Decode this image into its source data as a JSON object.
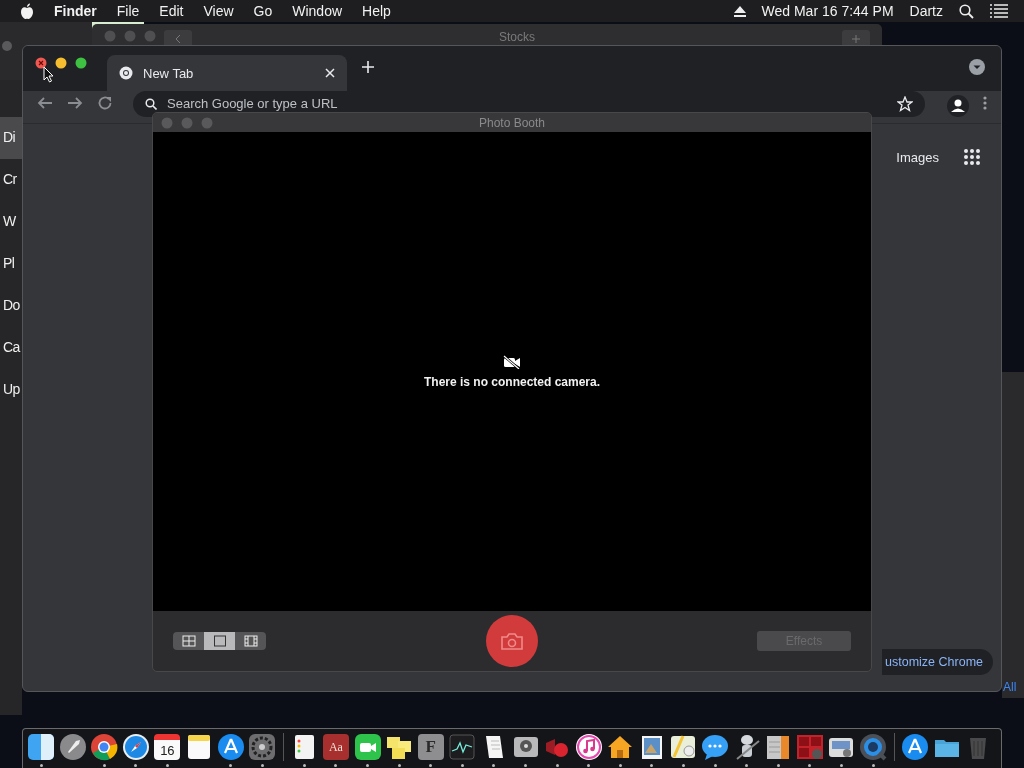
{
  "menu_bar": {
    "app": "Finder",
    "menus": [
      "File",
      "Edit",
      "View",
      "Go",
      "Window",
      "Help"
    ],
    "clock": "Wed Mar 16  7:44 PM",
    "user": "Dartz"
  },
  "background": {
    "stocks_title": "Stocks",
    "sidebar_items": [
      {
        "label": "Di",
        "selected": true
      },
      {
        "label": "Cr",
        "selected": false
      },
      {
        "label": "W",
        "selected": false
      },
      {
        "label": "Pl",
        "selected": false
      },
      {
        "label": "Do",
        "selected": false
      },
      {
        "label": "Ca",
        "selected": false
      },
      {
        "label": "Up",
        "selected": false
      }
    ],
    "right_link": "All"
  },
  "chrome": {
    "tab": {
      "title": "New Tab"
    },
    "omnibox": {
      "placeholder": "Search Google or type a URL"
    },
    "links": [
      "Images"
    ],
    "customize_button": "ustomize Chrome"
  },
  "photo_booth": {
    "title": "Photo Booth",
    "message": "There is no connected camera.",
    "view_modes": [
      {
        "kind": "grid",
        "selected": false
      },
      {
        "kind": "single",
        "selected": true
      },
      {
        "kind": "strip",
        "selected": false
      }
    ],
    "effects": {
      "label": "Effects",
      "disabled": true
    }
  },
  "dock": {
    "items": [
      {
        "kind": "app",
        "running": true
      },
      {
        "kind": "app",
        "running": false
      },
      {
        "kind": "app",
        "running": true
      },
      {
        "kind": "app",
        "running": true
      },
      {
        "kind": "app",
        "running": true,
        "text": "16"
      },
      {
        "kind": "app",
        "running": false
      },
      {
        "kind": "app",
        "running": true
      },
      {
        "kind": "app",
        "running": true
      },
      {
        "kind": "divider"
      },
      {
        "kind": "app",
        "running": true
      },
      {
        "kind": "app",
        "running": true,
        "text": "Aa"
      },
      {
        "kind": "app",
        "running": true
      },
      {
        "kind": "app",
        "running": true
      },
      {
        "kind": "app",
        "running": true,
        "text": "F"
      },
      {
        "kind": "app",
        "running": true
      },
      {
        "kind": "app",
        "running": true
      },
      {
        "kind": "app",
        "running": true
      },
      {
        "kind": "app",
        "running": true
      },
      {
        "kind": "app",
        "running": true
      },
      {
        "kind": "app",
        "running": true
      },
      {
        "kind": "app",
        "running": true
      },
      {
        "kind": "app",
        "running": true
      },
      {
        "kind": "app",
        "running": true
      },
      {
        "kind": "app",
        "running": true
      },
      {
        "kind": "app",
        "running": true
      },
      {
        "kind": "app",
        "running": true
      },
      {
        "kind": "app",
        "running": true
      },
      {
        "kind": "app",
        "running": true
      },
      {
        "kind": "divider"
      },
      {
        "kind": "app",
        "running": false
      },
      {
        "kind": "app",
        "running": false
      },
      {
        "kind": "app",
        "running": false
      }
    ]
  }
}
